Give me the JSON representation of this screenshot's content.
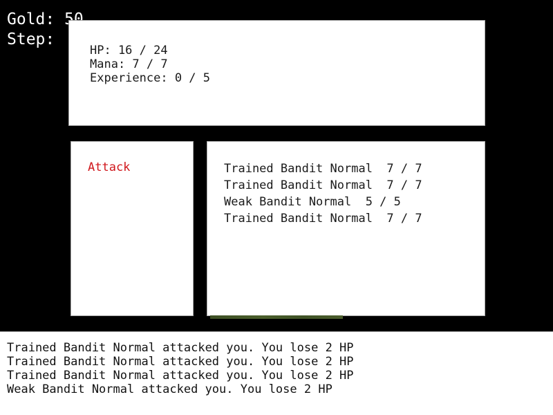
{
  "hud": {
    "gold_label": "Gold: 50",
    "step_label": "Step: "
  },
  "stats": {
    "hp": "HP: 16 / 24",
    "mana": "Mana: 7 / 7",
    "experience": "Experience: 0 / 5"
  },
  "actions": {
    "attack_label": "Attack",
    "attack_color": "#d0161b"
  },
  "enemies": [
    {
      "label": "Trained Bandit Normal  7 / 7",
      "name": "Trained Bandit Normal",
      "hp": "7 / 7"
    },
    {
      "label": "Trained Bandit Normal  7 / 7",
      "name": "Trained Bandit Normal",
      "hp": "7 / 7"
    },
    {
      "label": "Weak Bandit Normal  5 / 5",
      "name": "Weak Bandit Normal",
      "hp": "5 / 5"
    },
    {
      "label": "Trained Bandit Normal  7 / 7",
      "name": "Trained Bandit Normal",
      "hp": "7 / 7"
    }
  ],
  "log": [
    "Trained Bandit Normal attacked you. You lose 2 HP",
    "Trained Bandit Normal attacked you. You lose 2 HP",
    "Trained Bandit Normal attacked you. You lose 2 HP",
    "Weak Bandit Normal attacked you. You lose 2 HP"
  ]
}
